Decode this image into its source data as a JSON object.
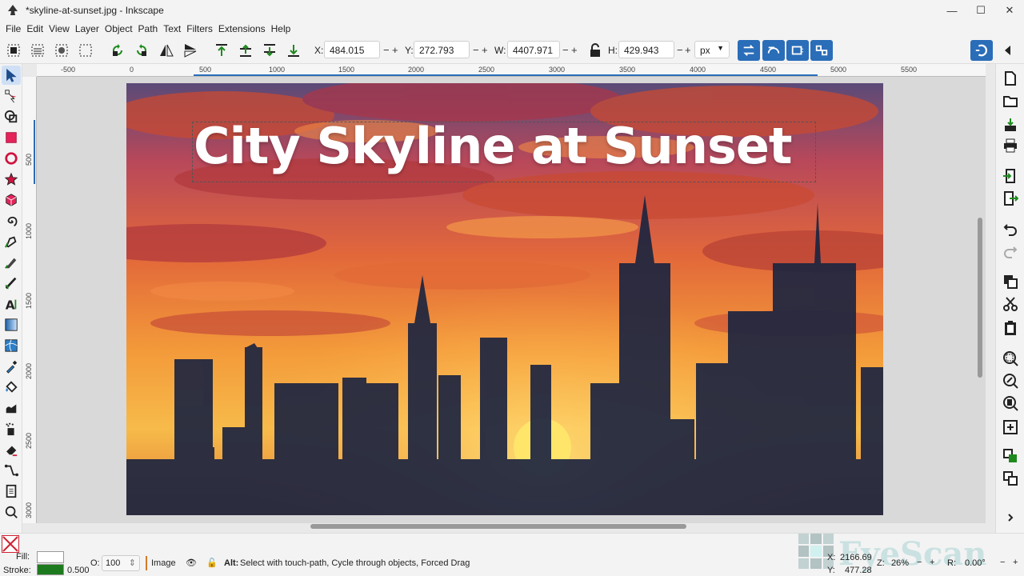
{
  "window": {
    "title": "*skyline-at-sunset.jpg - Inkscape",
    "minimize_icon": "minimize-icon",
    "maximize_icon": "maximize-icon",
    "close_icon": "close-icon"
  },
  "menu": [
    "File",
    "Edit",
    "View",
    "Layer",
    "Object",
    "Path",
    "Text",
    "Filters",
    "Extensions",
    "Help"
  ],
  "controls": {
    "x_label": "X:",
    "x_value": "484.015",
    "y_label": "Y:",
    "y_value": "272.793",
    "w_label": "W:",
    "w_value": "4407.971",
    "h_label": "H:",
    "h_value": "429.943",
    "unit": "px",
    "minus": "−",
    "plus": "+"
  },
  "ruler": {
    "h_ticks": [
      "-500",
      "0",
      "500",
      "1000",
      "1500",
      "2000",
      "2500",
      "3000",
      "3500",
      "4000",
      "4500",
      "5000",
      "5500"
    ],
    "v_ticks": [
      "500",
      "1000",
      "1500",
      "2000",
      "2500",
      "3000"
    ]
  },
  "canvas": {
    "headline": "City Skyline at Sunset"
  },
  "status": {
    "fill_label": "Fill:",
    "stroke_label": "Stroke:",
    "stroke_width": "0.500",
    "opacity_label": "O:",
    "opacity_value": "100",
    "layer_name": "Image",
    "message_bold": "Alt:",
    "message": "Select with touch-path, Cycle through objects, Forced Drag",
    "cursor_x_label": "X:",
    "cursor_x": "2166.69",
    "cursor_y_label": "Y:",
    "cursor_y": "477.28",
    "zoom_label": "Z:",
    "zoom_value": "26%",
    "rotate_label": "R:",
    "rotate_value": "0.00°",
    "watermark": "FyeScan"
  },
  "colors": {
    "accent": "#2a6db8",
    "fill_swatch": "#ffffff",
    "stroke_swatch": "#1e7a1e"
  }
}
